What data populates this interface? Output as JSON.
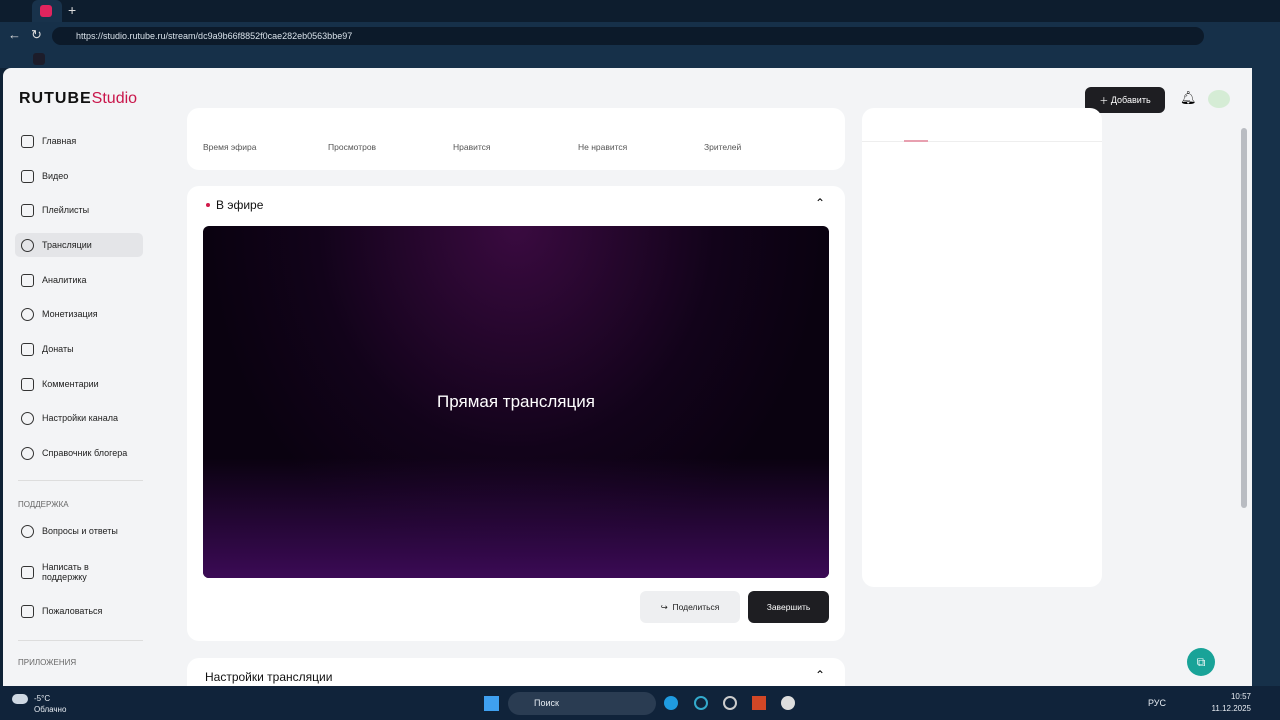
{
  "browser": {
    "url": "https://studio.rutube.ru/stream/dc9a9b66f8852f0cae282eb0563bbe97"
  },
  "header": {
    "logo_main": "RUTUBE",
    "logo_sub": "Studio",
    "add_label": "Добавить"
  },
  "sidebar": {
    "items": [
      {
        "label": "Главная"
      },
      {
        "label": "Видео"
      },
      {
        "label": "Плейлисты"
      },
      {
        "label": "Трансляции"
      },
      {
        "label": "Аналитика"
      },
      {
        "label": "Монетизация"
      },
      {
        "label": "Донаты"
      },
      {
        "label": "Комментарии"
      },
      {
        "label": "Настройки канала"
      },
      {
        "label": "Справочник блогера"
      }
    ],
    "support_title": "ПОДДЕРЖКА",
    "support_items": [
      {
        "label": "Вопросы и ответы"
      },
      {
        "label": "Написать в поддержку"
      },
      {
        "label": "Пожаловаться"
      }
    ],
    "apps_title": "ПРИЛОЖЕНИЯ"
  },
  "stats": [
    {
      "label": "Время эфира"
    },
    {
      "label": "Просмотров"
    },
    {
      "label": "Нравится"
    },
    {
      "label": "Не нравится"
    },
    {
      "label": "Зрителей"
    }
  ],
  "live": {
    "title": "В эфире",
    "video_text": "Прямая трансляция",
    "share_label": "Поделиться",
    "finish_label": "Завершить"
  },
  "settings": {
    "title": "Настройки трансляции"
  },
  "taskbar": {
    "temp": "-5°C",
    "weather": "Облачно",
    "search": "Поиск",
    "lang": "РУС",
    "time": "10:57",
    "date": "11.12.2025"
  }
}
